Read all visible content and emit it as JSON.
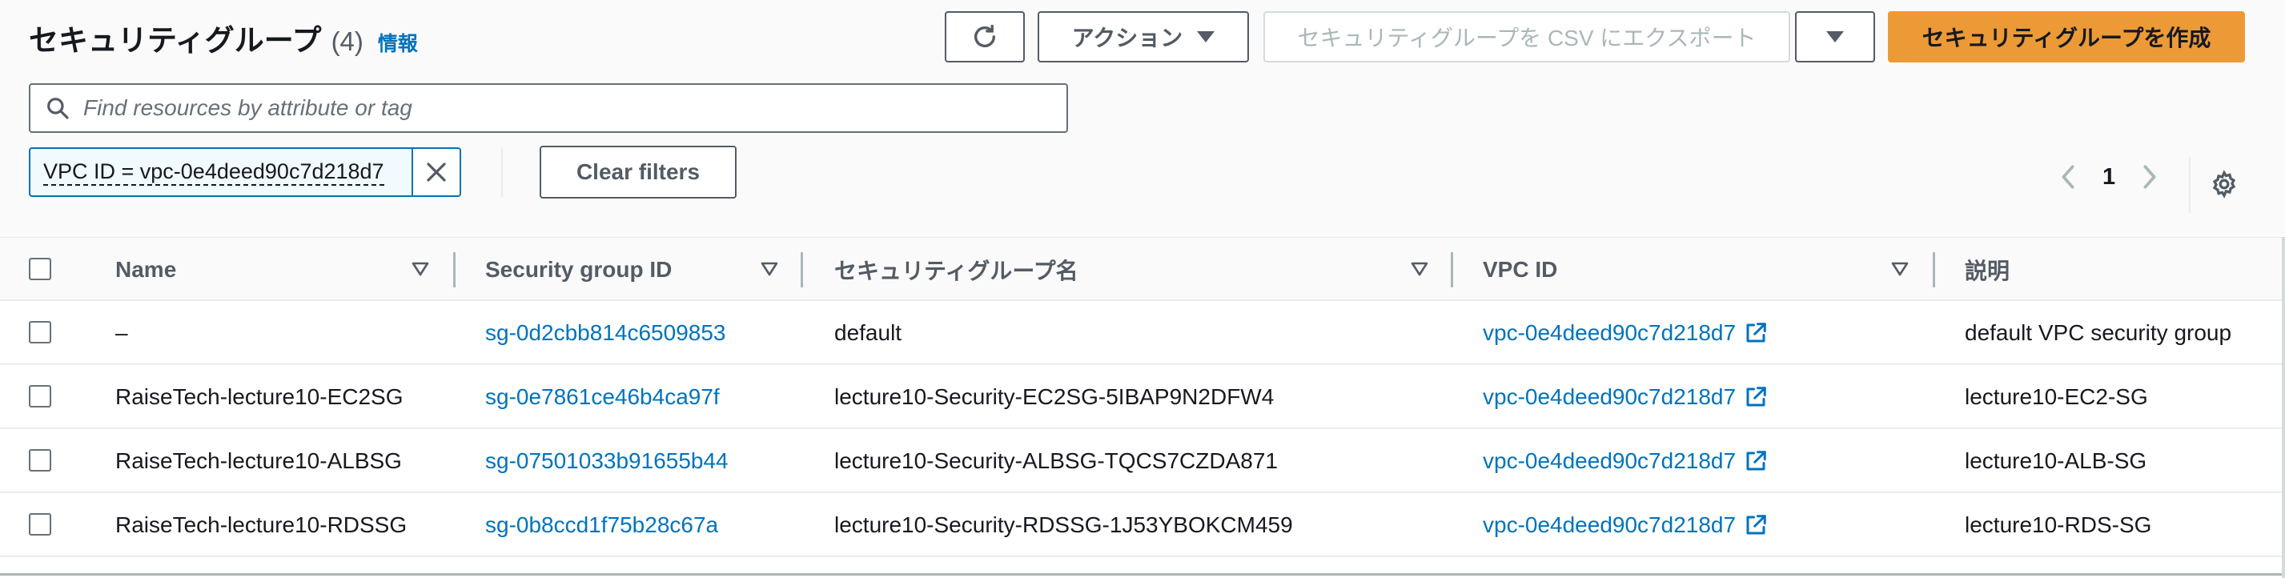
{
  "header": {
    "title": "セキュリティグループ",
    "count": "(4)",
    "info": "情報"
  },
  "toolbar": {
    "refresh_icon": "refresh-icon",
    "actions_label": "アクション",
    "export_label": "セキュリティグループを CSV にエクスポート",
    "create_label": "セキュリティグループを作成"
  },
  "search": {
    "placeholder": "Find resources by attribute or tag",
    "value": ""
  },
  "filter": {
    "token": "VPC ID = vpc-0e4deed90c7d218d7",
    "clear_label": "Clear filters"
  },
  "pagination": {
    "current_page": "1"
  },
  "table": {
    "columns": [
      "Name",
      "Security group ID",
      "セキュリティグループ名",
      "VPC ID",
      "説明"
    ],
    "rows": [
      {
        "name": "–",
        "sg_id": "sg-0d2cbb814c6509853",
        "sg_name": "default",
        "vpc_id": "vpc-0e4deed90c7d218d7",
        "description": "default VPC security group"
      },
      {
        "name": "RaiseTech-lecture10-EC2SG",
        "sg_id": "sg-0e7861ce46b4ca97f",
        "sg_name": "lecture10-Security-EC2SG-5IBAP9N2DFW4",
        "vpc_id": "vpc-0e4deed90c7d218d7",
        "description": "lecture10-EC2-SG"
      },
      {
        "name": "RaiseTech-lecture10-ALBSG",
        "sg_id": "sg-07501033b91655b44",
        "sg_name": "lecture10-Security-ALBSG-TQCS7CZDA871",
        "vpc_id": "vpc-0e4deed90c7d218d7",
        "description": "lecture10-ALB-SG"
      },
      {
        "name": "RaiseTech-lecture10-RDSSG",
        "sg_id": "sg-0b8ccd1f75b28c67a",
        "sg_name": "lecture10-Security-RDSSG-1J53YBOKCM459",
        "vpc_id": "vpc-0e4deed90c7d218d7",
        "description": "lecture10-RDS-SG"
      }
    ]
  },
  "colors": {
    "link": "#0073bb",
    "primary_button": "#ec9a36",
    "text": "#16191f",
    "muted": "#545b64"
  }
}
